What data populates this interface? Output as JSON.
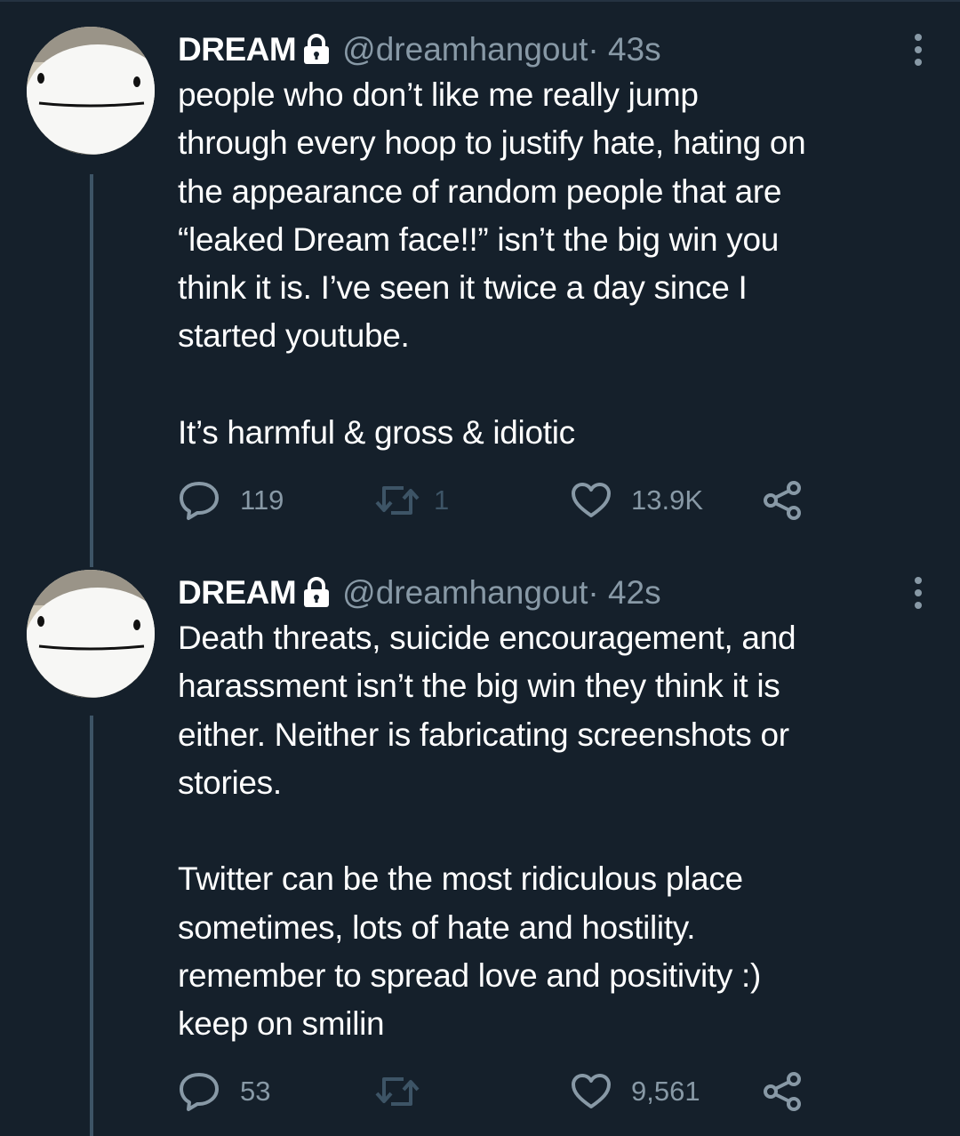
{
  "tweets": [
    {
      "display_name": "DREAM",
      "handle": "@dreamhangout",
      "time": " · 43s",
      "text": "people who don’t like me really jump\nthrough every hoop to justify hate, hating on\nthe appearance of random people that are\n“leaked Dream face!!” isn’t the big win you\nthink it is. I’ve seen it twice a day since I\nstarted youtube.\n\nIt’s harmful & gross & idiotic",
      "replies": "119",
      "retweets": "1",
      "likes": "13.9K"
    },
    {
      "display_name": "DREAM",
      "handle": "@dreamhangout",
      "time": " · 42s",
      "text": "Death threats, suicide encouragement, and\nharassment isn’t the big win they think it is\neither. Neither is fabricating screenshots or\nstories.\n\nTwitter can be the most ridiculous place\nsometimes, lots of hate and hostility.\nremember to spread love and positivity :)\nkeep on smilin",
      "replies": "53",
      "retweets": "",
      "likes": "9,561"
    }
  ],
  "icons": {
    "lock": "lock-icon",
    "more": "more-vertical-icon",
    "reply": "reply-icon",
    "retweet": "retweet-icon",
    "like": "heart-icon",
    "share": "share-icon"
  },
  "colors": {
    "background": "#15202b",
    "text": "#ffffff",
    "secondary": "#8899a6",
    "thread_line": "#3d5466"
  }
}
